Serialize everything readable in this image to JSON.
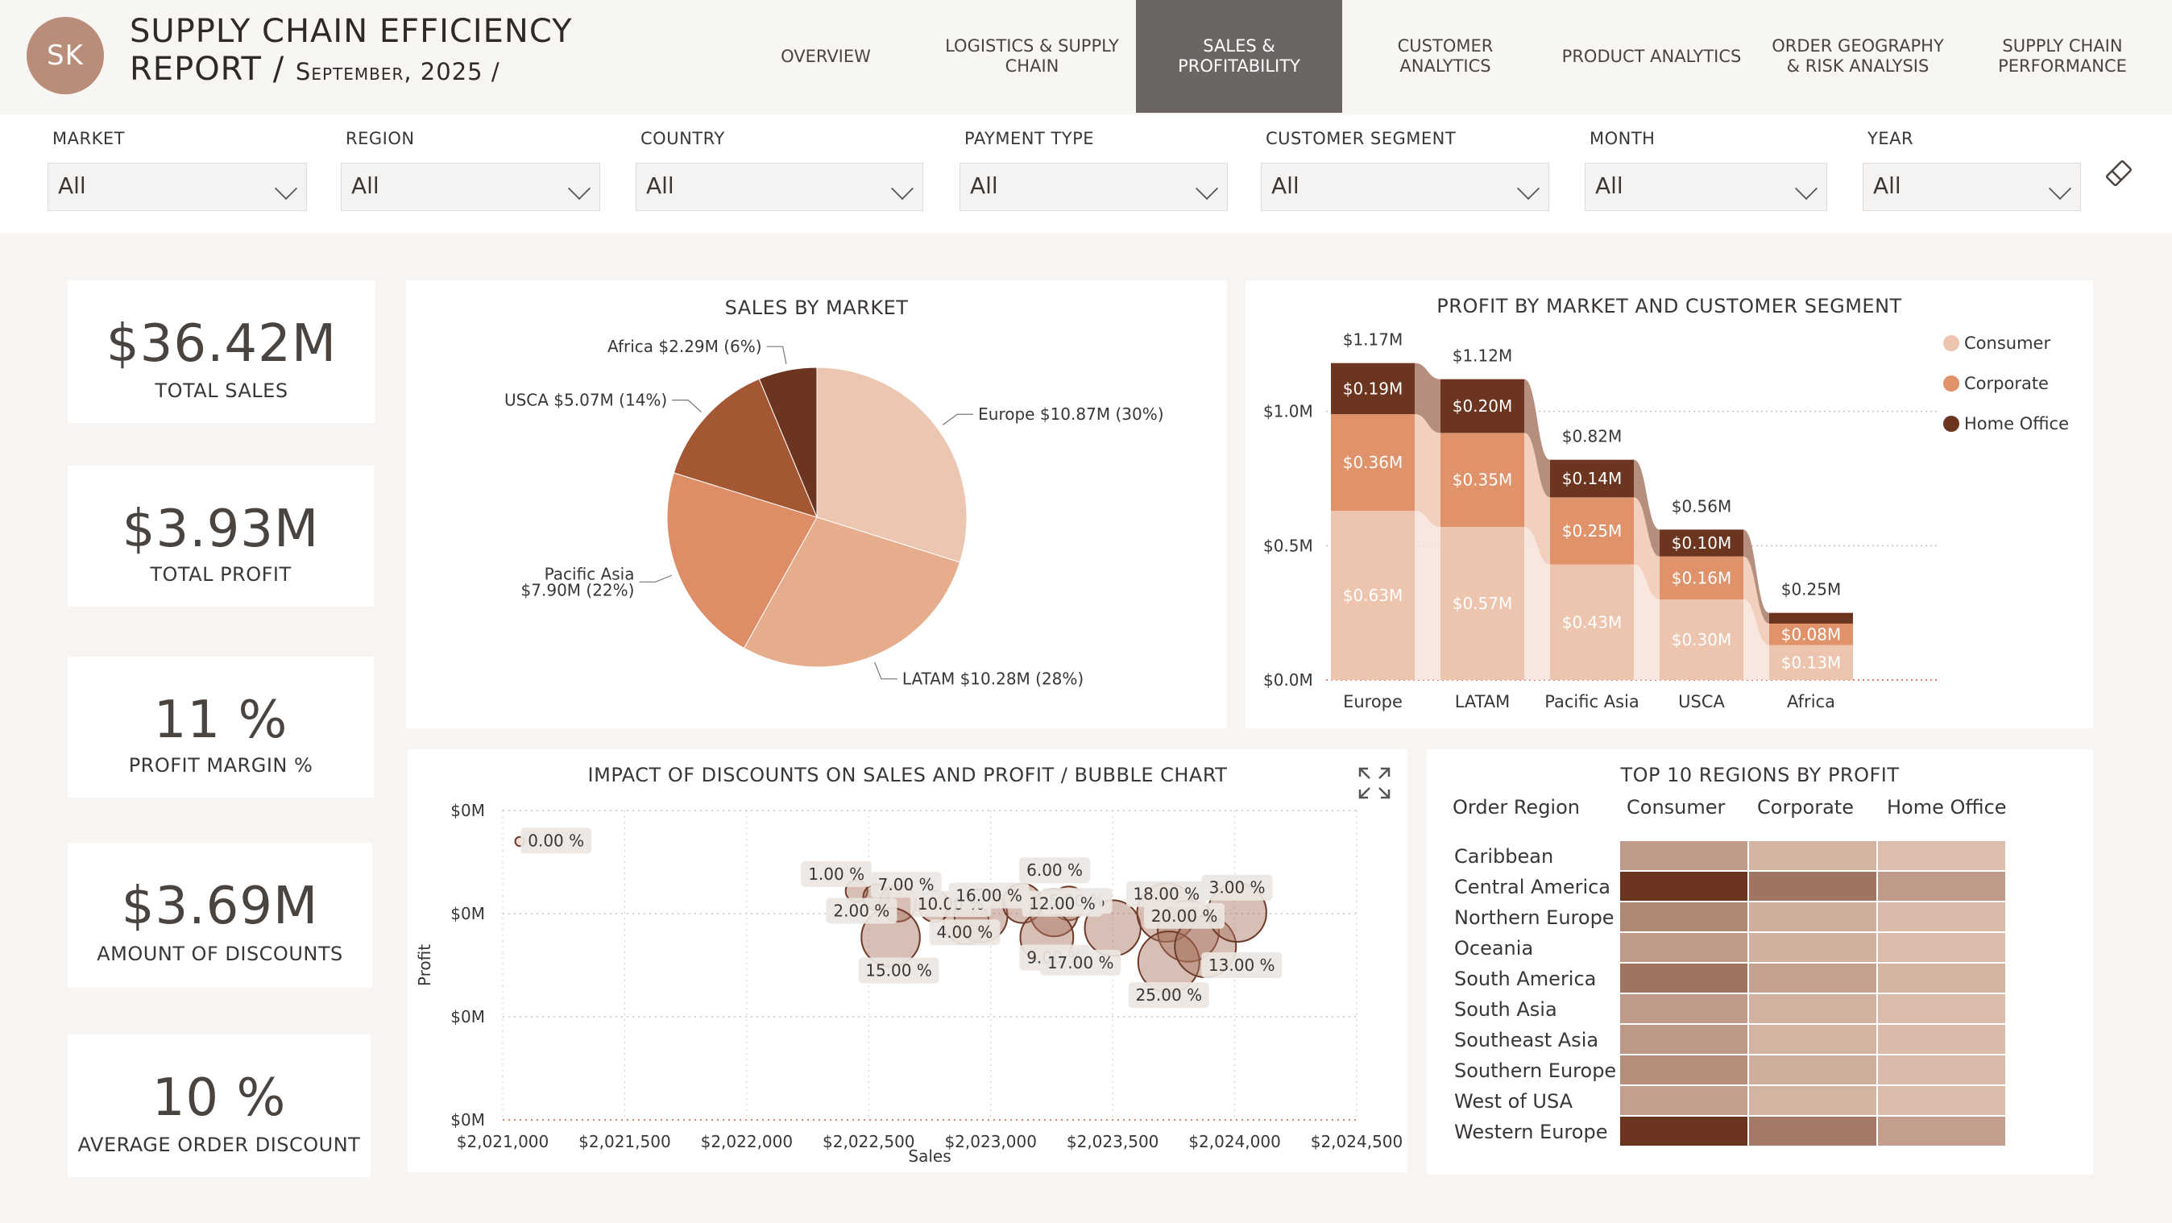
{
  "header": {
    "avatar": "SK",
    "title_line1": "SUPPLY CHAIN EFFICIENCY",
    "title_line2": "REPORT /",
    "title_date": "September, 2025 /"
  },
  "tabs": [
    {
      "label": "OVERVIEW"
    },
    {
      "label": "LOGISTICS & SUPPLY CHAIN"
    },
    {
      "label": "SALES & PROFITABILITY"
    },
    {
      "label": "CUSTOMER ANALYTICS"
    },
    {
      "label": "PRODUCT ANALYTICS"
    },
    {
      "label": "ORDER GEOGRAPHY & RISK ANALYSIS"
    },
    {
      "label": "SUPPLY CHAIN PERFORMANCE"
    }
  ],
  "active_tab": "SALES & PROFITABILITY",
  "filters": [
    {
      "label": "MARKET",
      "value": "All"
    },
    {
      "label": "REGION",
      "value": "All"
    },
    {
      "label": "COUNTRY",
      "value": "All"
    },
    {
      "label": "PAYMENT TYPE",
      "value": "All"
    },
    {
      "label": "CUSTOMER SEGMENT",
      "value": "All"
    },
    {
      "label": "MONTH",
      "value": "All"
    },
    {
      "label": "YEAR",
      "value": "All"
    }
  ],
  "kpis": [
    {
      "value": "$36.42M",
      "label": "TOTAL SALES"
    },
    {
      "value": "$3.93M",
      "label": "TOTAL PROFIT"
    },
    {
      "value": "11 %",
      "label": "PROFIT MARGIN %"
    },
    {
      "value": "$3.69M",
      "label": "AMOUNT OF DISCOUNTS"
    },
    {
      "value": "10 %",
      "label": "AVERAGE ORDER DISCOUNT"
    }
  ],
  "colors": {
    "consumer": "#edc5ae",
    "corporate": "#e0926a",
    "home_office": "#6b3520",
    "accent_dark": "#6b6664"
  },
  "chart_data": [
    {
      "type": "pie",
      "title": "SALES BY MARKET",
      "slices": [
        {
          "label": "Europe",
          "value": 10.87,
          "text": "Europe $10.87M (30%)",
          "color": "#ecc6b0"
        },
        {
          "label": "LATAM",
          "value": 10.28,
          "text": "LATAM $10.28M (28%)",
          "color": "#e6ad8c"
        },
        {
          "label": "Pacific Asia",
          "value": 7.9,
          "text": "Pacific Asia\n$7.90M (22%)",
          "color": "#de8e66"
        },
        {
          "label": "USCA",
          "value": 5.07,
          "text": "USCA $5.07M (14%)",
          "color": "#a45733"
        },
        {
          "label": "Africa",
          "value": 2.29,
          "text": "Africa $2.29M (6%)",
          "color": "#6b3520"
        }
      ]
    },
    {
      "type": "bar",
      "stacked": true,
      "title": "PROFIT BY MARKET AND CUSTOMER SEGMENT",
      "categories": [
        "Europe",
        "LATAM",
        "Pacific Asia",
        "USCA",
        "Africa"
      ],
      "totals": [
        "$1.17M",
        "$1.12M",
        "$0.82M",
        "$0.56M",
        "$0.25M"
      ],
      "series": [
        {
          "name": "Consumer",
          "values": [
            0.63,
            0.57,
            0.43,
            0.3,
            0.13
          ],
          "labels": [
            "$0.63M",
            "$0.57M",
            "$0.43M",
            "$0.30M",
            "$0.13M"
          ],
          "color": "#edc5ae"
        },
        {
          "name": "Corporate",
          "values": [
            0.36,
            0.35,
            0.25,
            0.16,
            0.08
          ],
          "labels": [
            "$0.36M",
            "$0.35M",
            "$0.25M",
            "$0.16M",
            "$0.08M"
          ],
          "color": "#e0926a"
        },
        {
          "name": "Home Office",
          "values": [
            0.19,
            0.2,
            0.14,
            0.1,
            0.04
          ],
          "labels": [
            "$0.19M",
            "$0.20M",
            "$0.14M",
            "$0.10M",
            ""
          ],
          "color": "#6b3520"
        }
      ],
      "yticks": [
        "$0.0M",
        "$0.5M",
        "$1.0M"
      ],
      "ylim": [
        0,
        1.2
      ],
      "legend": "top-right"
    },
    {
      "type": "scatter",
      "title": "IMPACT OF DISCOUNTS ON SALES AND PROFIT / BUBBLE CHART",
      "xlabel": "Sales",
      "ylabel": "Profit",
      "xticks": [
        "$2,021,000",
        "$2,021,500",
        "$2,022,000",
        "$2,022,500",
        "$2,023,000",
        "$2,023,500",
        "$2,024,000",
        "$2,024,500"
      ],
      "yticks": [
        "$0M",
        "$0M",
        "$0M",
        "$0M"
      ],
      "xlim": [
        2021000,
        2024500
      ],
      "points": [
        {
          "label": "0.00 %",
          "x": 2021070,
          "y": 0.9,
          "size": 0.05
        },
        {
          "label": "1.00 %",
          "x": 2022450,
          "y": 0.74,
          "size": 0.28
        },
        {
          "label": "2.00 %",
          "x": 2022530,
          "y": 0.72,
          "size": 0.35
        },
        {
          "label": "7.00 %",
          "x": 2022620,
          "y": 0.7,
          "size": 0.55
        },
        {
          "label": "10.00 %",
          "x": 2022770,
          "y": 0.69,
          "size": 0.45
        },
        {
          "label": "15.00 %",
          "x": 2022590,
          "y": 0.59,
          "size": 0.95
        },
        {
          "label": "4.00 %",
          "x": 2022900,
          "y": 0.64,
          "size": 0.7
        },
        {
          "label": "16.00 %",
          "x": 2022960,
          "y": 0.66,
          "size": 0.85
        },
        {
          "label": "6.00 %",
          "x": 2023130,
          "y": 0.7,
          "size": 0.6
        },
        {
          "label": "5.00 %",
          "x": 2023320,
          "y": 0.7,
          "size": 0.5
        },
        {
          "label": "12.00 %",
          "x": 2023260,
          "y": 0.67,
          "size": 0.75
        },
        {
          "label": "9.00 %",
          "x": 2023230,
          "y": 0.59,
          "size": 0.85
        },
        {
          "label": "17.00 %",
          "x": 2023500,
          "y": 0.62,
          "size": 0.9
        },
        {
          "label": "18.00 %",
          "x": 2023720,
          "y": 0.67,
          "size": 0.95
        },
        {
          "label": "20.00 %",
          "x": 2023810,
          "y": 0.61,
          "size": 1.0
        },
        {
          "label": "25.00 %",
          "x": 2023730,
          "y": 0.51,
          "size": 1.0
        },
        {
          "label": "13.00 %",
          "x": 2023880,
          "y": 0.56,
          "size": 1.0
        },
        {
          "label": "3.00 %",
          "x": 2024010,
          "y": 0.67,
          "size": 0.95
        }
      ]
    },
    {
      "type": "heatmap",
      "title": "TOP 10 REGIONS BY PROFIT",
      "row_header": "Order Region",
      "columns": [
        "Consumer",
        "Corporate",
        "Home Office"
      ],
      "rows": [
        "Caribbean",
        "Central America",
        "Northern Europe",
        "Oceania",
        "South America",
        "South Asia",
        "Southeast Asia",
        "Southern Europe",
        "West of USA",
        "Western Europe"
      ],
      "values": [
        [
          0.28,
          0.12,
          0.05
        ],
        [
          1.0,
          0.55,
          0.28
        ],
        [
          0.42,
          0.15,
          0.08
        ],
        [
          0.28,
          0.14,
          0.06
        ],
        [
          0.55,
          0.24,
          0.12
        ],
        [
          0.28,
          0.13,
          0.06
        ],
        [
          0.3,
          0.12,
          0.07
        ],
        [
          0.38,
          0.16,
          0.08
        ],
        [
          0.26,
          0.12,
          0.06
        ],
        [
          0.98,
          0.52,
          0.26
        ]
      ]
    }
  ]
}
